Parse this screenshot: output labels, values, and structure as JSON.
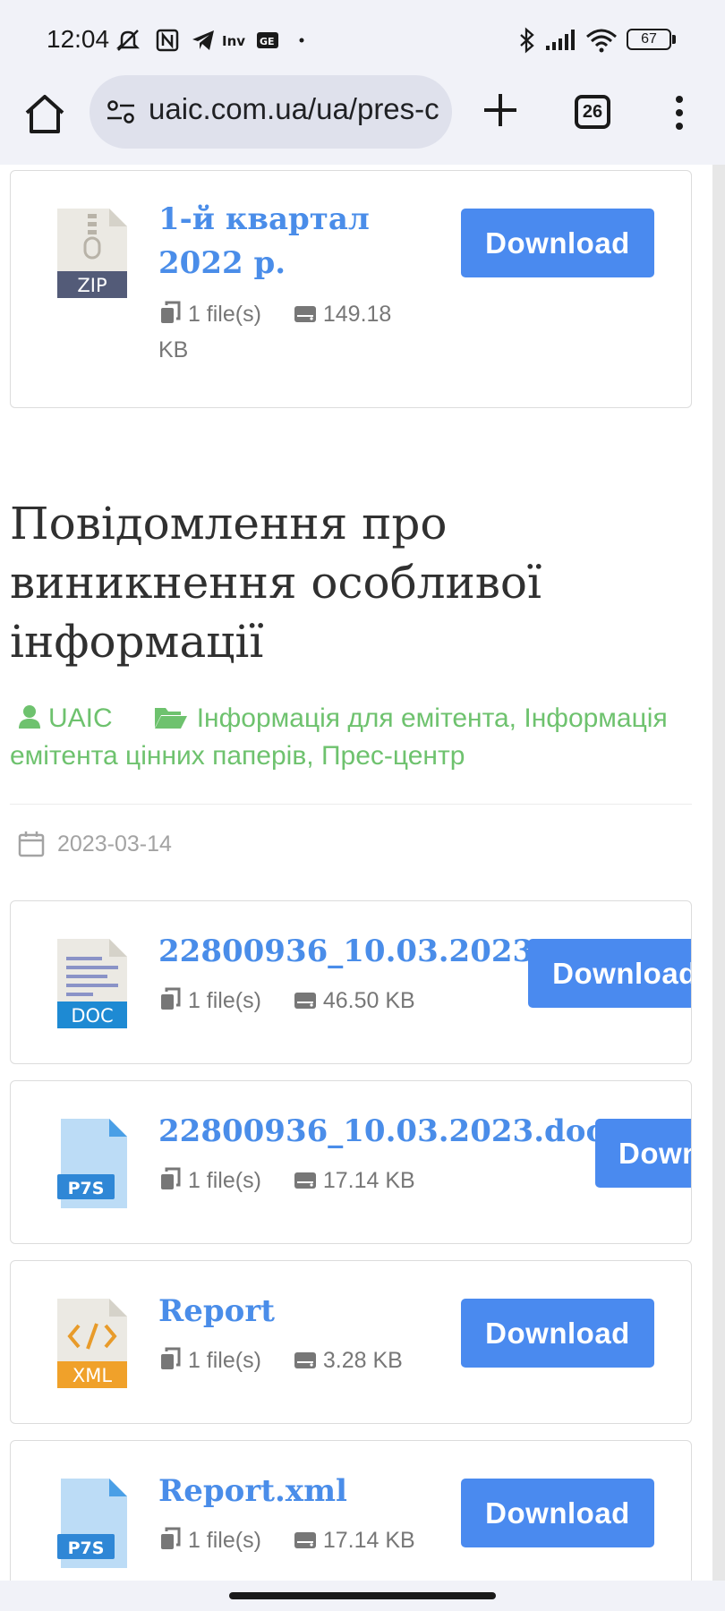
{
  "status_bar": {
    "time": "12:04",
    "battery": "67"
  },
  "browser": {
    "url": "uaic.com.ua/ua/pres-c",
    "tab_count": "26"
  },
  "cards_top": [
    {
      "name": "1-й квартал 2022 р.",
      "file_type": "ZIP",
      "files": "1 file(s)",
      "size": "149.18 KB",
      "download_label": "Download"
    }
  ],
  "article": {
    "title": "Повідомлення про виникнення особливої інформації",
    "author": "UAIC",
    "categories": "Інформація для емітента, Інформація емітента цінних паперів, Прес-центр",
    "date": "2023-03-14"
  },
  "files": [
    {
      "name": "22800936_10.03.2023",
      "file_type": "DOC",
      "files": "1 file(s)",
      "size": "46.50 KB",
      "download_label": "Download"
    },
    {
      "name": "22800936_10.03.2023.doc",
      "file_type": "P7S",
      "files": "1 file(s)",
      "size": "17.14 KB",
      "download_label": "Downlo"
    },
    {
      "name": "Report",
      "file_type": "XML",
      "files": "1 file(s)",
      "size": "3.28 KB",
      "download_label": "Download"
    },
    {
      "name": "Report.xml",
      "file_type": "P7S",
      "files": "1 file(s)",
      "size": "17.14 KB",
      "download_label": "Download"
    }
  ],
  "colors": {
    "link_blue": "#4a8de9",
    "button_blue": "#4a8aef",
    "category_green": "#6ec26e"
  }
}
